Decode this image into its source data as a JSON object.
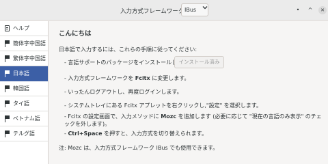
{
  "header": {
    "framework_label": "入力方式フレームワーク:",
    "framework_value": "IBus",
    "minimize_glyph": "•",
    "maximize_glyph": "^",
    "close_glyph": "✕"
  },
  "sidebar": {
    "items": [
      {
        "label": "ヘルプ",
        "icon": "help-document-icon"
      },
      {
        "label": "簡体字中国語",
        "icon": "flag-icon"
      },
      {
        "label": "繁体字中国語",
        "icon": "flag-icon"
      },
      {
        "label": "日本語",
        "icon": "flag-icon",
        "selected": true
      },
      {
        "label": "韓国語",
        "icon": "flag-icon"
      },
      {
        "label": "タイ語",
        "icon": "flag-icon"
      },
      {
        "label": "ベトナム語",
        "icon": "flag-icon"
      },
      {
        "label": "テルグ語",
        "icon": "flag-icon"
      }
    ]
  },
  "main": {
    "heading": "こんにちは",
    "intro": "日本語で入力するには、これらの手順に従ってください:",
    "step1": "- 言語サポートのパッケージをインストールします:",
    "install_button": "インストール済み",
    "step2_pre": "- 入力方式フレームワークを ",
    "step2_bold": "Fcitx",
    "step2_post": " に変更します。",
    "step3": "- いったんログアウトし、再度ログインします。",
    "step4": "- システムトレイにある Fcitx アプレットを右クリックし,\"設定\" を選択します。",
    "step5_pre": "- Fcitx の設定画面で、入力メソッドに ",
    "step5_bold": "Mozc",
    "step5_post": " を追加します (必要に応じて \"現在の言語のみ表示\" のチェックを外します)。",
    "step6_pre": "- ",
    "step6_bold": "Ctrl+Space",
    "step6_post": " を押すと、入力方式を切り替えられます。",
    "note": "注: Mozc は、入力方式フレームワーク IBus でも使用できます。"
  },
  "colors": {
    "selected_bg": "#3c5fa6",
    "window_bg": "#f6f5f4",
    "titlebar_bg": "#ebebeb"
  }
}
